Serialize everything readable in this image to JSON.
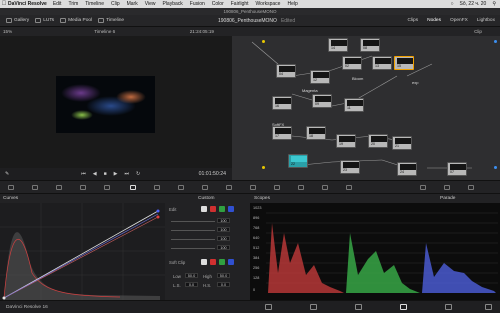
{
  "menubar": {
    "app": "DaVinci Resolve",
    "items": [
      "Edit",
      "Trim",
      "Timeline",
      "Clip",
      "Mark",
      "View",
      "Playback",
      "Fusion",
      "Color",
      "Fairlight",
      "Workspace",
      "Help"
    ],
    "clock": "Sô, 22 ч. 20"
  },
  "window": {
    "title": "190806_PenthouseMONO"
  },
  "toolbar": {
    "gallery": "Gallery",
    "luts": "LUTs",
    "media_pool": "Media Pool",
    "timeline": "Timeline",
    "project": "190806_PenthouseMONO",
    "edited": "Edited",
    "clips": "Clips",
    "nodes": "Nodes",
    "openfx": "OpenFX",
    "lightbox": "Lightbox"
  },
  "viewer": {
    "zoom": "15%",
    "timeline_name": "Timeline 6",
    "timecode": "21:24:05:19",
    "playhead_tc": "01:01:50:24"
  },
  "nodes": {
    "header": "Clip",
    "labels": {
      "bloom": "Bloom",
      "magenta": "Magenta",
      "softfx": "SoftFX",
      "exp": "exp"
    },
    "numbers": [
      "14",
      "08",
      "04",
      "12",
      "02",
      "13",
      "15",
      "16",
      "09",
      "11",
      "17",
      "18",
      "19",
      "20",
      "21",
      "22",
      "23",
      "24",
      "07",
      "06",
      "10"
    ]
  },
  "curves": {
    "title": "Curves",
    "mode": "Custom",
    "edit": "Edit",
    "values": [
      "100",
      "100",
      "100",
      "100"
    ],
    "soft_clip": "Soft Clip",
    "low": "Low",
    "high": "High",
    "ls": "L.S.",
    "hs": "H.S.",
    "low_val": "50.0",
    "high_val": "50.0",
    "ls_val": "0.0",
    "hs_val": "0.0"
  },
  "scopes": {
    "title": "Scopes",
    "mode": "Parade",
    "scale": [
      "1023",
      "896",
      "768",
      "640",
      "512",
      "384",
      "256",
      "128",
      "0"
    ]
  },
  "bottombar": {
    "app": "DaVinci Resolve 16"
  }
}
